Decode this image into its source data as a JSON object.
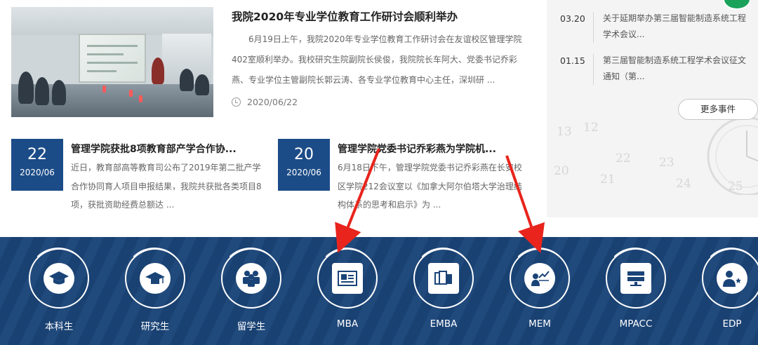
{
  "featured": {
    "title": "我院2020年专业学位教育工作研讨会顺利举办",
    "summary": "6月19日上午，我院2020年专业学位教育工作研讨会在友谊校区管理学院402室顺利举办。我校研究生院副院长侯俊，我院院长车阿大、党委书记乔彩燕、专业学位主管副院长郭云涛、各专业学位教育中心主任，深圳研 ...",
    "date": "2020/06/22"
  },
  "news": [
    {
      "day": "22",
      "year_month": "2020/06",
      "title": "管理学院获批8项教育部产学合作协...",
      "summary": "近日，教育部高等教育司公布了2019年第二批产学合作协同育人项目申报结果，我院共获批各类项目8项，获批资助经费总额达 ..."
    },
    {
      "day": "20",
      "year_month": "2020/06",
      "title": "管理学院党委书记乔彩燕为学院机...",
      "summary": "6月18日下午，管理学院党委书记乔彩燕在长安校区学院212会议室以《加拿大阿尔伯塔大学治理结构体系的思考和启示》为 ..."
    }
  ],
  "events": {
    "items": [
      {
        "date": "03.20",
        "title": "关于延期举办第三届智能制造系统工程学术会议..."
      },
      {
        "date": "01.15",
        "title": "第三届智能制造系统工程学术会议征文通知（第..."
      }
    ],
    "more_label": "更多事件",
    "watch_numbers": [
      "13",
      "12",
      "21",
      "20",
      "22",
      "23",
      "24",
      "25"
    ]
  },
  "nav": {
    "items": [
      {
        "label": "本科生",
        "icon": "graduation-cap-icon"
      },
      {
        "label": "研究生",
        "icon": "mortarboard-icon"
      },
      {
        "label": "留学生",
        "icon": "people-group-icon"
      },
      {
        "label": "MBA",
        "icon": "id-card-icon"
      },
      {
        "label": "EMBA",
        "icon": "documents-icon"
      },
      {
        "label": "MEM",
        "icon": "presenter-chart-icon"
      },
      {
        "label": "MPACC",
        "icon": "server-icon"
      },
      {
        "label": "EDP",
        "icon": "person-stars-icon"
      }
    ]
  },
  "colors": {
    "brand_blue": "#1c4c88",
    "band_blue": "#1a4478",
    "annotation_red": "#e8241c"
  }
}
